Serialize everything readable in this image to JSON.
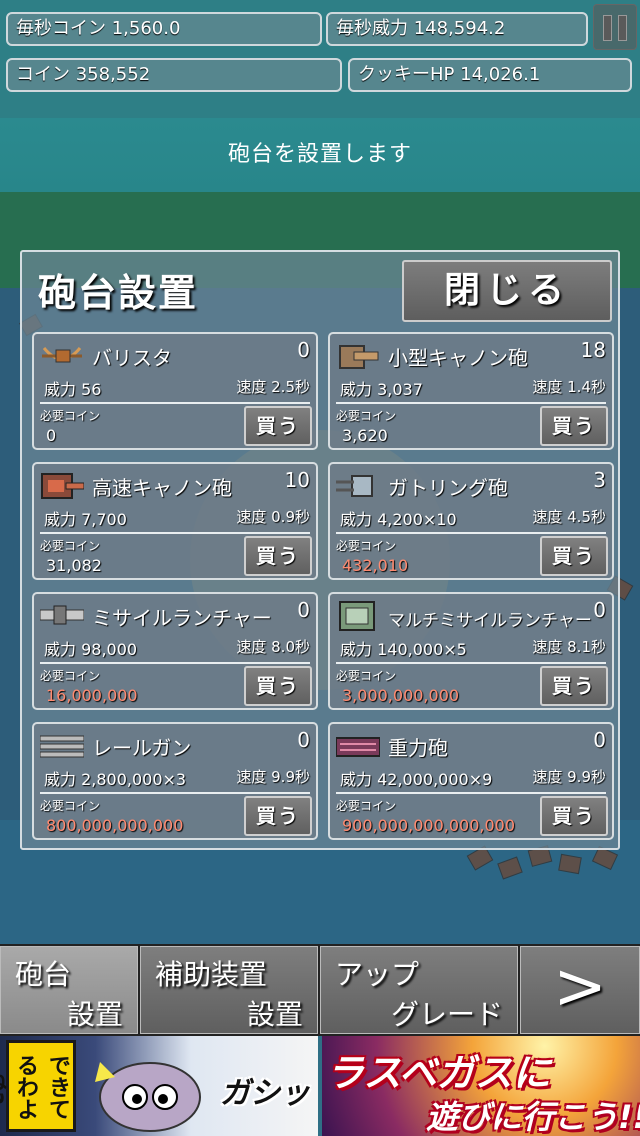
{
  "stats": {
    "coins_per_sec": "毎秒コイン 1,560.0",
    "power_per_sec": "毎秒威力 148,594.2",
    "coins": "コイン 358,552",
    "cookie_hp": "クッキーHP 14,026.1"
  },
  "message": "砲台を設置します",
  "panel": {
    "title": "砲台設置",
    "close_label": "閉じる",
    "cost_label": "必要コイン",
    "buy_label": "買う"
  },
  "turrets": [
    {
      "name": "バリスタ",
      "count": "0",
      "power": "威力 56",
      "speed": "速度 2.5秒",
      "cost": "0",
      "cost_color": "#ffffff",
      "icon": "ballista-icon"
    },
    {
      "name": "小型キャノン砲",
      "count": "18",
      "power": "威力 3,037",
      "speed": "速度 1.4秒",
      "cost": "3,620",
      "cost_color": "#ffffff",
      "icon": "small-cannon-icon"
    },
    {
      "name": "高速キャノン砲",
      "count": "10",
      "power": "威力 7,700",
      "speed": "速度 0.9秒",
      "cost": "31,082",
      "cost_color": "#ffffff",
      "icon": "fast-cannon-icon"
    },
    {
      "name": "ガトリング砲",
      "count": "3",
      "power": "威力 4,200×10",
      "speed": "速度 4.5秒",
      "cost": "432,010",
      "cost_color": "#ff8a70",
      "icon": "gatling-icon"
    },
    {
      "name": "ミサイルランチャー",
      "count": "0",
      "power": "威力 98,000",
      "speed": "速度 8.0秒",
      "cost": "16,000,000",
      "cost_color": "#ff8a70",
      "icon": "missile-launcher-icon"
    },
    {
      "name": "マルチミサイルランチャー",
      "count": "0",
      "power": "威力 140,000×5",
      "speed": "速度 8.1秒",
      "cost": "3,000,000,000",
      "cost_color": "#ff8a70",
      "icon": "multi-missile-icon"
    },
    {
      "name": "レールガン",
      "count": "0",
      "power": "威力 2,800,000×3",
      "speed": "速度 9.9秒",
      "cost": "800,000,000,000",
      "cost_color": "#ff8a70",
      "icon": "railgun-icon"
    },
    {
      "name": "重力砲",
      "count": "0",
      "power": "威力 42,000,000×9",
      "speed": "速度 9.9秒",
      "cost": "900,000,000,000,000",
      "cost_color": "#ff8a70",
      "icon": "gravity-cannon-icon"
    }
  ],
  "nav": {
    "turret": {
      "l1": "砲台",
      "l2": "設置"
    },
    "support": {
      "l1": "補助装置",
      "l2": "設置"
    },
    "upgrade": {
      "l1": "アップ",
      "l2": "グレード"
    },
    "next": ">"
  },
  "ads": {
    "left_vertical": "できてるわよね?",
    "left_sfx": "ガシッ",
    "right_line1": "ラスベガスに",
    "right_line2": "遊びに行こう!!"
  }
}
